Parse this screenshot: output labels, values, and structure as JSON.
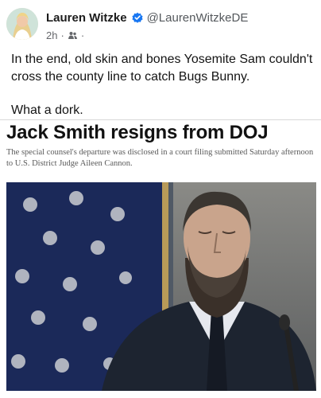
{
  "author": {
    "name": "Lauren Witzke",
    "handle": "@LaurenWitzkeDE",
    "time": "2h",
    "separator": "·",
    "audience_icon": "friends-icon",
    "verified_icon": "verified-badge-icon"
  },
  "post": {
    "line1": "In the end, old skin and bones Yosemite Sam couldn't cross the county line to catch Bugs Bunny.",
    "line2": "What a dork."
  },
  "article": {
    "headline": "Jack Smith resigns from DOJ",
    "deck": "The special counsel's departure was disclosed in a court filing submitted Saturday afternoon to U.S. District Judge Aileen Cannon."
  },
  "colors": {
    "verified": "#1877f2",
    "name": "#1c1c1c",
    "secondary": "#65676b"
  }
}
